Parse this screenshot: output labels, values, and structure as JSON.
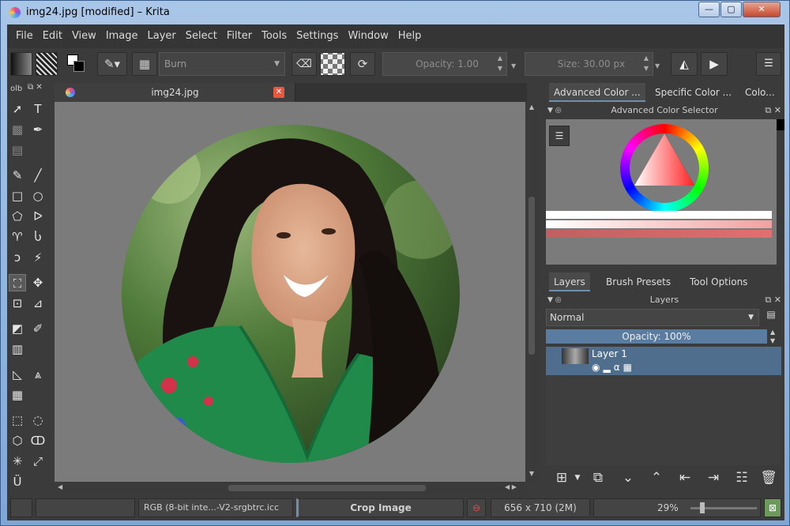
{
  "window": {
    "title": "img24.jpg [modified] – Krita",
    "min": "—",
    "max": "▢",
    "close": "✕"
  },
  "menu": [
    "File",
    "Edit",
    "View",
    "Image",
    "Layer",
    "Select",
    "Filter",
    "Tools",
    "Settings",
    "Window",
    "Help"
  ],
  "toolbar": {
    "brush_preset": "Burn",
    "opacity": "Opacity:  1.00",
    "size": "Size:  30.00 px"
  },
  "toolbox": {
    "header": "olb"
  },
  "document": {
    "tab_title": "img24.jpg"
  },
  "right": {
    "tabs": [
      "Advanced Color ...",
      "Specific Color ...",
      "Colo..."
    ],
    "color_dock_title": "Advanced Color Selector",
    "layer_tabs": [
      "Layers",
      "Brush Presets",
      "Tool Options"
    ],
    "layers_dock_title": "Layers",
    "blend_mode": "Normal",
    "opacity": "Opacity:  100%",
    "layers": [
      {
        "name": "Layer 1"
      }
    ]
  },
  "status": {
    "color_profile": "RGB (8-bit inte...-V2-srgbtrc.icc",
    "tool": "Crop Image",
    "dimensions": "656 x 710 (2M)",
    "zoom": "29%"
  },
  "colors": {
    "accent": "#4f6e8e",
    "panel": "#3b3b3b",
    "canvas_bg": "#7b7b7b"
  }
}
